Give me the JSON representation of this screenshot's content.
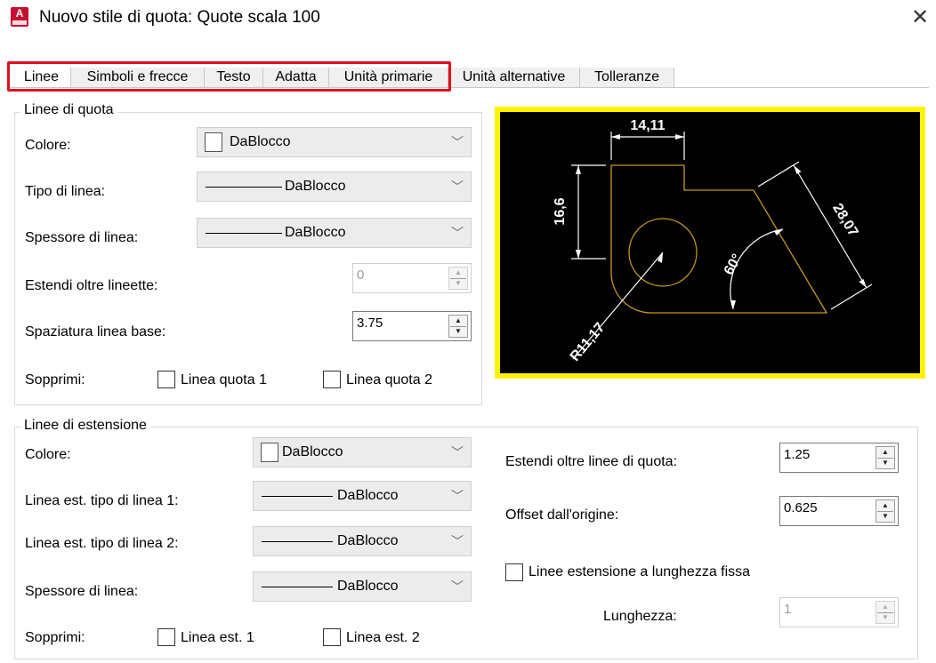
{
  "window": {
    "title": "Nuovo stile di quota: Quote scala 100",
    "close_icon": "close-icon"
  },
  "tabs": [
    "Linee",
    "Simboli e frecce",
    "Testo",
    "Adatta",
    "Unità primarie",
    "Unità alternative",
    "Tolleranze"
  ],
  "dimension_lines": {
    "legend": "Linee di quota",
    "color_label": "Colore:",
    "color_value": "DaBlocco",
    "linetype_label": "Tipo di linea:",
    "linetype_value": "DaBlocco",
    "lineweight_label": "Spessore di linea:",
    "lineweight_value": "DaBlocco",
    "extend_ticks_label": "Estendi oltre lineette:",
    "extend_ticks_value": "0",
    "baseline_spacing_label": "Spaziatura linea base:",
    "baseline_spacing_value": "3.75",
    "suppress_label": "Sopprimi:",
    "suppress_1": "Linea quota 1",
    "suppress_2": "Linea quota 2"
  },
  "extension_lines": {
    "legend": "Linee di estensione",
    "color_label": "Colore:",
    "color_value": "DaBlocco",
    "ext1_label": "Linea est. tipo di linea 1:",
    "ext1_value": "DaBlocco",
    "ext2_label": "Linea est. tipo di linea 2:",
    "ext2_value": "DaBlocco",
    "lineweight_label": "Spessore di linea:",
    "lineweight_value": "DaBlocco",
    "suppress_label": "Sopprimi:",
    "suppress_1": "Linea est. 1",
    "suppress_2": "Linea est. 2",
    "extend_beyond_label": "Estendi oltre linee di quota:",
    "extend_beyond_value": "1.25",
    "offset_label": "Offset dall'origine:",
    "offset_value": "0.625",
    "fixed_length_label": "Linee estensione a lunghezza fissa",
    "length_label": "Lunghezza:",
    "length_value": "1"
  },
  "preview": {
    "dim_top": "14,11",
    "dim_left": "16,6",
    "dim_right": "28,07",
    "dim_angle": "60°",
    "dim_radius": "R11,17"
  },
  "colors": {
    "highlight": "#e10f1e",
    "preview_border": "#fff200",
    "geometry": "#c8961e"
  }
}
